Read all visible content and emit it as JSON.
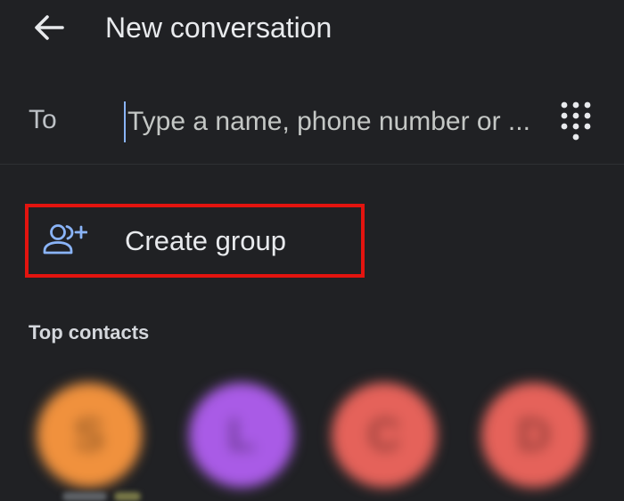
{
  "header": {
    "back_icon": "arrow-back-icon",
    "title": "New conversation"
  },
  "recipient": {
    "label": "To",
    "placeholder": "Type a name, phone number or ...",
    "value": "",
    "dialpad_icon": "dialpad-icon"
  },
  "actions": {
    "create_group": {
      "icon": "group-add-icon",
      "label": "Create group",
      "highlight_color": "#e3140f"
    }
  },
  "top_contacts": {
    "title": "Top contacts",
    "contacts": [
      {
        "initial": "S",
        "color": "#f0913d"
      },
      {
        "initial": "L",
        "color": "#a95be6"
      },
      {
        "initial": "C",
        "color": "#e5625a"
      },
      {
        "initial": "D",
        "color": "#e5625a"
      }
    ]
  },
  "colors": {
    "background": "#202124",
    "text_primary": "#e8eaed",
    "accent": "#8ab4f8"
  }
}
